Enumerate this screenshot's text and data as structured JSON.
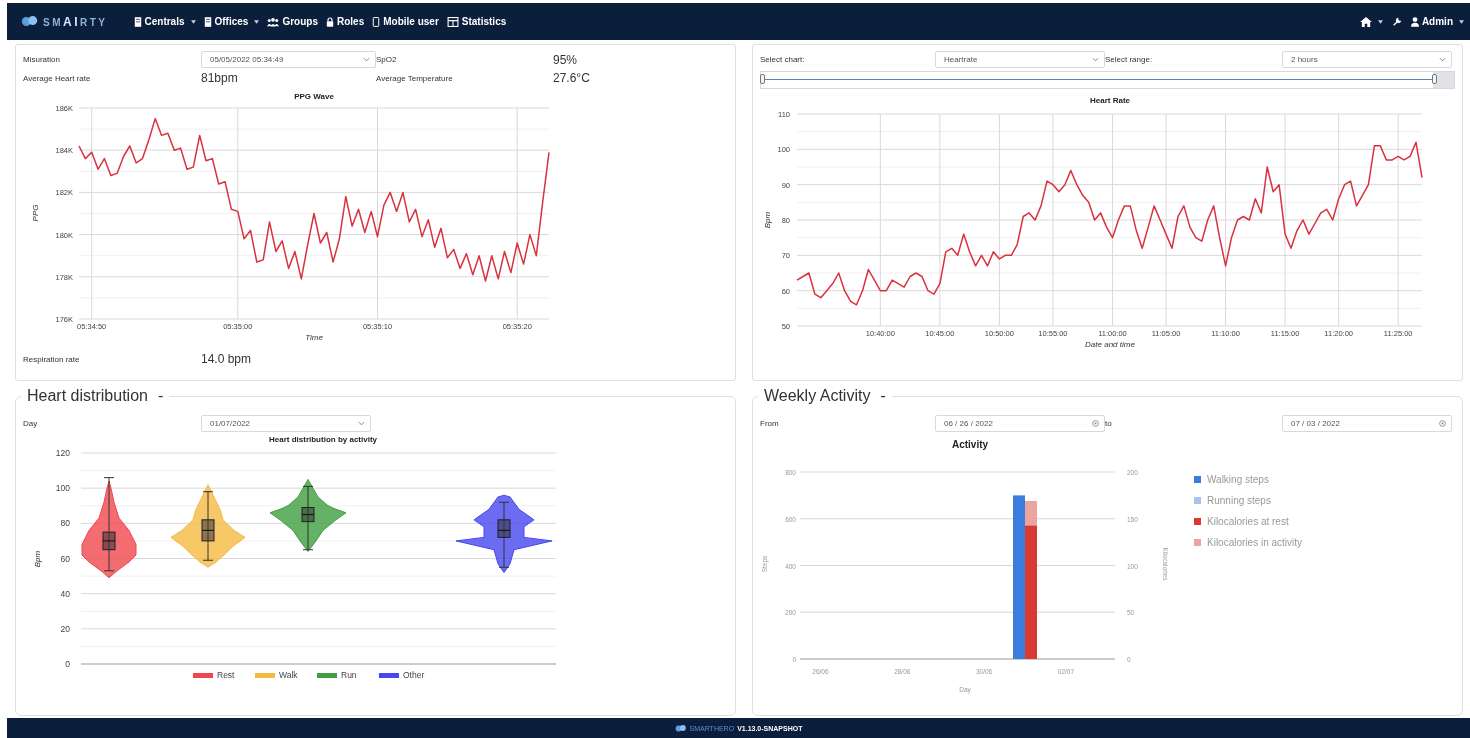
{
  "navbar": {
    "brand": {
      "start": "SM",
      "highlight": "AI",
      "end": "RTY"
    },
    "menu": [
      {
        "label": "Centrals",
        "dropdown": true
      },
      {
        "label": "Offices",
        "dropdown": true
      },
      {
        "label": "Groups",
        "dropdown": false
      },
      {
        "label": "Roles",
        "dropdown": false
      },
      {
        "label": "Mobile user",
        "dropdown": false
      },
      {
        "label": "Statistics",
        "dropdown": false
      }
    ],
    "right": [
      {
        "kind": "home",
        "dropdown": true
      },
      {
        "kind": "tools",
        "dropdown": false
      },
      {
        "kind": "user",
        "label": "Admin",
        "dropdown": true
      }
    ]
  },
  "measurement_panel": {
    "fields": [
      {
        "label": "Misuration",
        "kind": "select",
        "value": "05/05/2022 05:34:49"
      },
      {
        "label": "SpO2",
        "kind": "value",
        "value": "95%"
      },
      {
        "label": "Average Heart rate",
        "kind": "value",
        "value": "81bpm"
      },
      {
        "label": "Average Temperature",
        "kind": "value",
        "value": "27.6°C"
      }
    ],
    "chart_data": {
      "type": "line",
      "title": "PPG Wave",
      "xlabel": "Time",
      "ylabel": "PPG",
      "grid": true,
      "ylim": [
        176000,
        186000
      ],
      "categories": [
        null,
        null,
        "05:34:50",
        null,
        null,
        null,
        null,
        null,
        null,
        null,
        null,
        null,
        null,
        null,
        null,
        null,
        null,
        null,
        null,
        null,
        null,
        null,
        null,
        null,
        null,
        "05:35:00",
        null,
        null,
        null,
        null,
        null,
        null,
        null,
        null,
        null,
        null,
        null,
        null,
        null,
        null,
        null,
        null,
        null,
        null,
        null,
        null,
        null,
        "05:35:10",
        null,
        null,
        null,
        null,
        null,
        null,
        null,
        null,
        null,
        null,
        null,
        null,
        null,
        null,
        null,
        null,
        null,
        null,
        null,
        null,
        null,
        "05:35:20",
        null,
        null,
        null,
        null,
        null
      ],
      "yticks": [
        {
          "value": 176000,
          "label": "176K"
        },
        {
          "value": 178000,
          "label": "178K"
        },
        {
          "value": 180000,
          "label": "180K"
        },
        {
          "value": 182000,
          "label": "182K"
        },
        {
          "value": 184000,
          "label": "184K"
        },
        {
          "value": 186000,
          "label": "186K"
        }
      ],
      "series": [
        {
          "color": "#d9323f",
          "values": [
            184200,
            183600,
            183900,
            183100,
            183600,
            182800,
            182900,
            183700,
            184200,
            183400,
            183600,
            184500,
            185500,
            184700,
            184800,
            184000,
            184100,
            183100,
            183200,
            184700,
            183500,
            183600,
            182400,
            182500,
            181200,
            181100,
            179800,
            180200,
            178700,
            178800,
            180600,
            179200,
            179700,
            178400,
            179200,
            177900,
            179500,
            181000,
            179600,
            180100,
            178700,
            179800,
            181800,
            180400,
            181200,
            180100,
            181100,
            179900,
            181400,
            182000,
            181100,
            182000,
            180600,
            181200,
            179900,
            180700,
            179400,
            180300,
            178900,
            179300,
            178400,
            179100,
            178100,
            179000,
            177800,
            179000,
            177900,
            179200,
            178200,
            179600,
            178600,
            180000,
            179000,
            181500,
            183900
          ]
        }
      ]
    },
    "extra_fields": [
      {
        "label": "Respiration rate",
        "kind": "value",
        "value": "14.0 bpm"
      }
    ]
  },
  "heart_rate_panel": {
    "fields": [
      {
        "label": "Select chart:",
        "kind": "select",
        "value": "Heartrate"
      },
      {
        "label": "Select range:",
        "kind": "select",
        "value": "2 hours"
      }
    ],
    "range_slider": {
      "level": 0.97
    },
    "chart_data": {
      "type": "line",
      "title": "Heart Rate",
      "xlabel": "Date and time",
      "ylabel": "Bpm",
      "grid": true,
      "ylim": [
        50,
        110
      ],
      "categories": [
        null,
        null,
        null,
        null,
        null,
        null,
        null,
        null,
        null,
        null,
        null,
        null,
        null,
        null,
        "10:40:00",
        null,
        null,
        null,
        null,
        null,
        null,
        null,
        null,
        null,
        "10:45:00",
        null,
        null,
        null,
        null,
        null,
        null,
        null,
        null,
        null,
        "10:50:00",
        null,
        null,
        null,
        null,
        null,
        null,
        null,
        null,
        "10:55:00",
        null,
        null,
        null,
        null,
        null,
        null,
        null,
        null,
        null,
        "11:00:00",
        null,
        null,
        null,
        null,
        null,
        null,
        null,
        null,
        "11:05:00",
        null,
        null,
        null,
        null,
        null,
        null,
        null,
        null,
        null,
        "11:10:00",
        null,
        null,
        null,
        null,
        null,
        null,
        null,
        null,
        null,
        "11:15:00",
        null,
        null,
        null,
        null,
        null,
        null,
        null,
        null,
        "11:20:00",
        null,
        null,
        null,
        null,
        null,
        null,
        null,
        null,
        null,
        "11:25:00",
        null,
        null,
        null,
        null
      ],
      "yticks": [
        50,
        60,
        70,
        80,
        90,
        100,
        110
      ],
      "series": [
        {
          "color": "#d9323f",
          "values": [
            63,
            64,
            65,
            59,
            58,
            60,
            62,
            65,
            60,
            57,
            56,
            60,
            66,
            63,
            60,
            60,
            63,
            62,
            61,
            64,
            65,
            64,
            60,
            59,
            62,
            71,
            72,
            70,
            76,
            71,
            67,
            70,
            67,
            71,
            69,
            70,
            70,
            73,
            81,
            82,
            80,
            84,
            91,
            90,
            88,
            90,
            94,
            90,
            87,
            85,
            80,
            82,
            78,
            75,
            80,
            84,
            84,
            77,
            72,
            78,
            84,
            80,
            76,
            72,
            81,
            84,
            78,
            75,
            74,
            80,
            84,
            75,
            67,
            75,
            80,
            81,
            80,
            86,
            82,
            95,
            88,
            90,
            76,
            72,
            77,
            80,
            76,
            79,
            82,
            83,
            80,
            86,
            90,
            91,
            84,
            87,
            90,
            101,
            101,
            97,
            97,
            98,
            97,
            98,
            102,
            92
          ]
        }
      ]
    }
  },
  "heart_distribution": {
    "title": "Heart distribution",
    "toggle": "-",
    "fields": [
      {
        "label": "Day",
        "kind": "select",
        "value": "01/07/2022"
      }
    ],
    "violin_chart": {
      "title": "Heart distribution by activity",
      "ylabel": "Bpm",
      "yticks": [
        "120",
        "100",
        "80",
        "60",
        "40",
        "20",
        "0"
      ],
      "groups": [
        {
          "name": "Rest",
          "color": "#f0474f"
        },
        {
          "name": "Walk",
          "color": "#f5b942"
        },
        {
          "name": "Run",
          "color": "#3f9e3f"
        },
        {
          "name": "Other",
          "color": "#4747f0"
        }
      ]
    }
  },
  "weekly_activity": {
    "title": "Weekly Activity",
    "toggle": "-",
    "fields": [
      {
        "label": "From",
        "kind": "date",
        "value": "06 / 26 / 2022"
      },
      {
        "label": "to",
        "kind": "date",
        "value": "07 / 03 / 2022"
      }
    ],
    "chart_data": {
      "type": "bar",
      "title": "Activity",
      "xlabel": "Day",
      "ylabel": "Steps",
      "y2label": "Kilocalories",
      "stacked": true,
      "grid": true,
      "categories": [
        "26/06",
        null,
        "28/06",
        null,
        "30/06",
        null,
        "02/07",
        null
      ],
      "ylim": [
        0,
        800
      ],
      "yticks": [
        0,
        200,
        400,
        600,
        800
      ],
      "y2lim": [
        0,
        200
      ],
      "y2ticks": [
        0,
        50,
        100,
        150,
        200
      ],
      "series": [
        {
          "name": "Walking steps",
          "color": "#3b7ddd",
          "values": [
            0,
            0,
            0,
            0,
            0,
            700,
            0,
            0
          ]
        },
        {
          "name": "Running steps",
          "color": "#a9c3ee",
          "values": [
            0,
            0,
            0,
            0,
            0,
            0,
            0,
            0
          ]
        },
        {
          "name": "Kilocalories at rest",
          "color": "#d93a32",
          "axis": "y2",
          "values": [
            0,
            0,
            0,
            0,
            0,
            143,
            0,
            0
          ]
        },
        {
          "name": "Kilocalories in activity",
          "color": "#eba49e",
          "axis": "y2",
          "values": [
            0,
            0,
            0,
            0,
            0,
            26,
            0,
            0
          ]
        }
      ]
    }
  },
  "footer": {
    "brand": "SMARTHERO",
    "version": "V1.13.0-SNAPSHOT"
  }
}
